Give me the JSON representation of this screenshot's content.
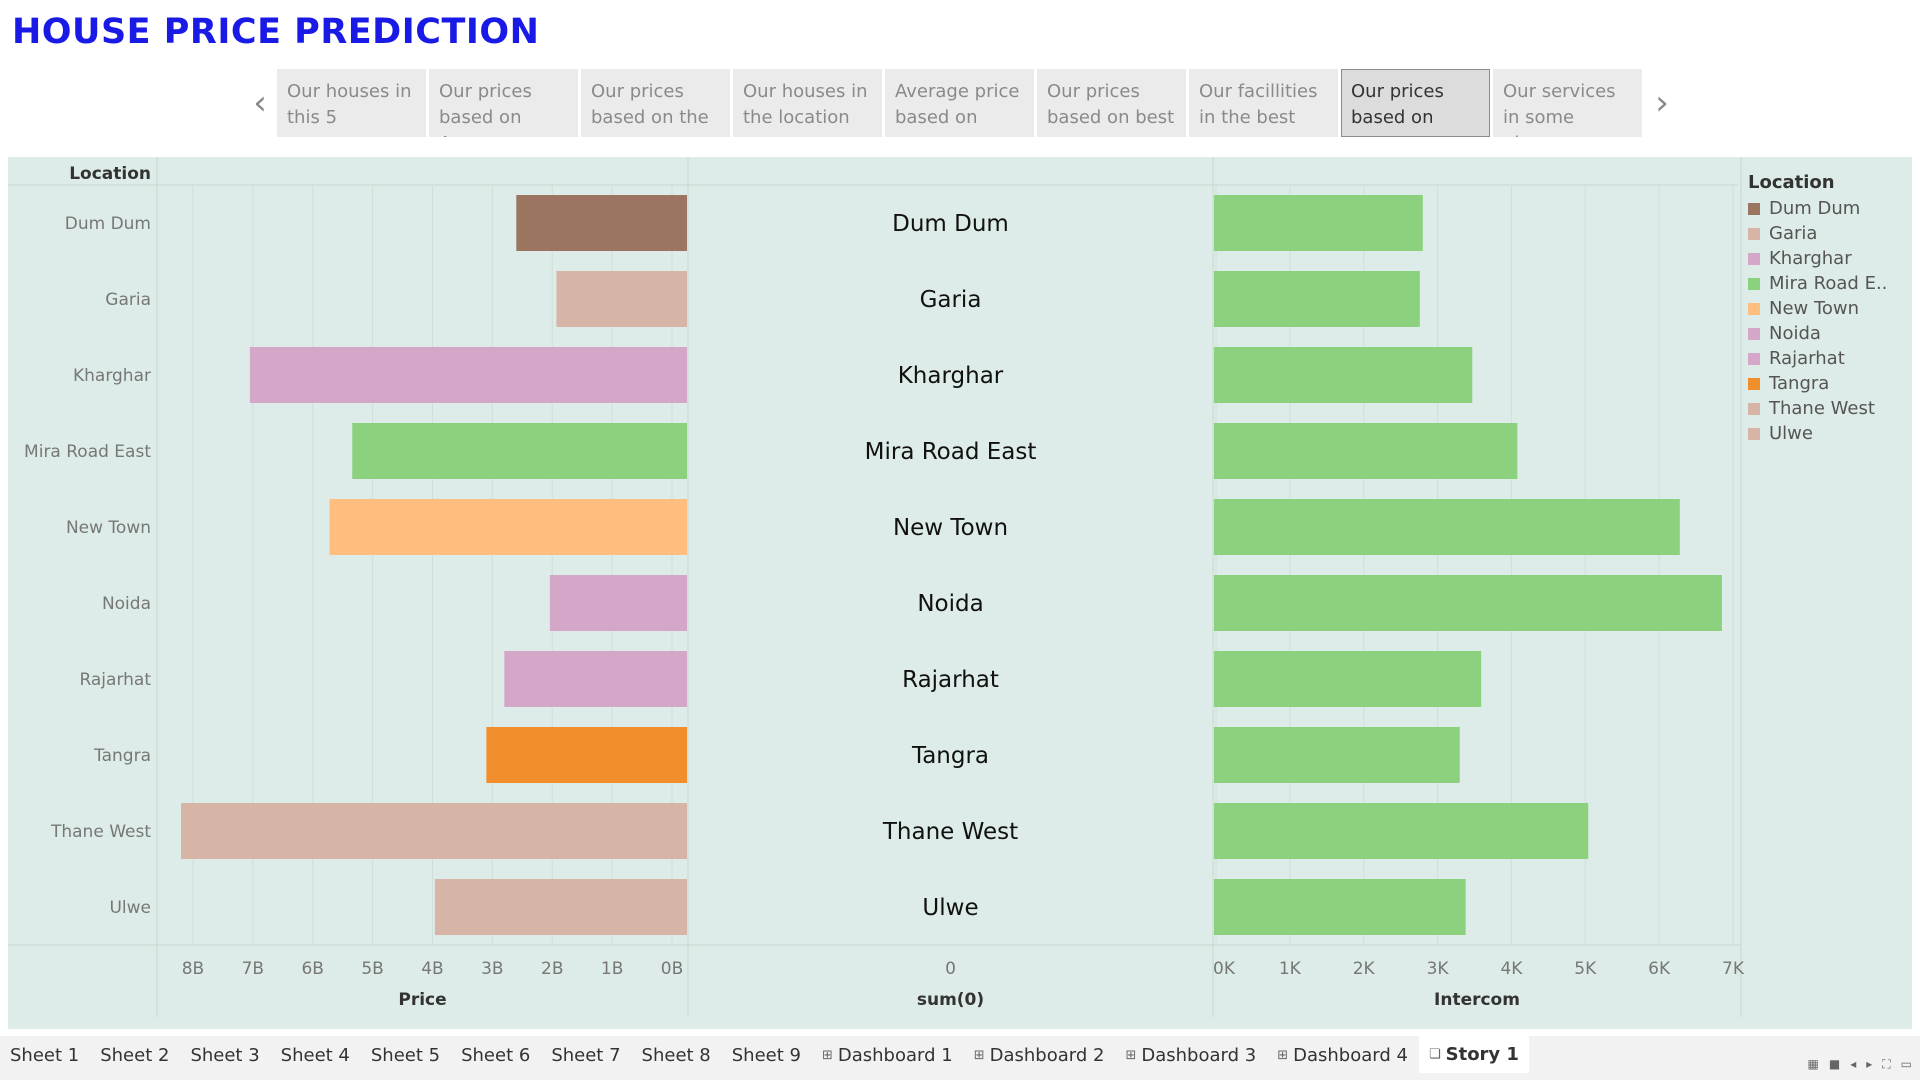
{
  "title": "HOUSE PRICE PREDICTION",
  "story_points": [
    {
      "label": "Our houses in this 5",
      "active": false
    },
    {
      "label": "Our prices based on Area",
      "active": false
    },
    {
      "label": "Our prices based on the",
      "active": false
    },
    {
      "label": "Our houses in the location",
      "active": false
    },
    {
      "label": "Average price based on",
      "active": false
    },
    {
      "label": "Our prices based on best",
      "active": false
    },
    {
      "label": "Our facillities in the best",
      "active": false
    },
    {
      "label": "Our prices based on",
      "active": true
    },
    {
      "label": "Our services in some places",
      "active": false
    }
  ],
  "nav": {
    "prev_icon": "chevron-left-icon",
    "next_icon": "chevron-right-icon"
  },
  "chart_data": {
    "type": "bar",
    "row_header": "Location",
    "categories": [
      "Dum Dum",
      "Garia",
      "Kharghar",
      "Mira Road East",
      "New Town",
      "Noida",
      "Rajarhat",
      "Tangra",
      "Thane West",
      "Ulwe"
    ],
    "colors": [
      "#9c7560",
      "#d7b5a6",
      "#d4a6c8",
      "#8cd17d",
      "#ffbe7d",
      "#d4a6c8",
      "#d4a6c8",
      "#f28e2b",
      "#d7b5a6",
      "#d7b5a6"
    ],
    "panels": [
      {
        "axis_label": "Price",
        "reversed": true,
        "range": [
          0,
          8200000000
        ],
        "ticks": [
          0,
          1000000000,
          2000000000,
          3000000000,
          4000000000,
          5000000000,
          6000000000,
          7000000000,
          8000000000
        ],
        "tick_labels": [
          "0B",
          "1B",
          "2B",
          "3B",
          "4B",
          "5B",
          "6B",
          "7B",
          "8B"
        ],
        "values": [
          2600000000,
          1930000000,
          7050000000,
          5340000000,
          5720000000,
          2040000000,
          2800000000,
          3100000000,
          8200000000,
          3960000000
        ]
      },
      {
        "axis_label": "sum(0)",
        "tick_labels": [
          "0"
        ]
      },
      {
        "axis_label": "Intercom",
        "reversed": false,
        "range": [
          0,
          7000
        ],
        "ticks": [
          0,
          1000,
          2000,
          3000,
          4000,
          5000,
          6000,
          7000
        ],
        "tick_labels": [
          "0K",
          "1K",
          "2K",
          "3K",
          "4K",
          "5K",
          "6K",
          "7K"
        ],
        "bar_color": "#8cd17d",
        "values": [
          2800,
          2760,
          3470,
          4080,
          6280,
          6850,
          3590,
          3300,
          5040,
          3380
        ]
      }
    ]
  },
  "legend": {
    "title": "Location",
    "items": [
      {
        "label": "Dum Dum",
        "color": "#9c7560"
      },
      {
        "label": "Garia",
        "color": "#d7b5a6"
      },
      {
        "label": "Kharghar",
        "color": "#d4a6c8"
      },
      {
        "label": "Mira Road E..",
        "color": "#8cd17d"
      },
      {
        "label": "New Town",
        "color": "#ffbe7d"
      },
      {
        "label": "Noida",
        "color": "#d4a6c8"
      },
      {
        "label": "Rajarhat",
        "color": "#d4a6c8"
      },
      {
        "label": "Tangra",
        "color": "#f28e2b"
      },
      {
        "label": "Thane West",
        "color": "#d7b5a6"
      },
      {
        "label": "Ulwe",
        "color": "#d7b5a6"
      }
    ]
  },
  "tabs": [
    {
      "label": "Sheet 1",
      "kind": "sheet"
    },
    {
      "label": "Sheet 2",
      "kind": "sheet"
    },
    {
      "label": "Sheet 3",
      "kind": "sheet"
    },
    {
      "label": "Sheet 4",
      "kind": "sheet"
    },
    {
      "label": "Sheet 5",
      "kind": "sheet"
    },
    {
      "label": "Sheet 6",
      "kind": "sheet"
    },
    {
      "label": "Sheet 7",
      "kind": "sheet"
    },
    {
      "label": "Sheet 8",
      "kind": "sheet"
    },
    {
      "label": "Sheet 9",
      "kind": "sheet"
    },
    {
      "label": "Dashboard 1",
      "kind": "dashboard"
    },
    {
      "label": "Dashboard 2",
      "kind": "dashboard"
    },
    {
      "label": "Dashboard 3",
      "kind": "dashboard"
    },
    {
      "label": "Dashboard 4",
      "kind": "dashboard"
    },
    {
      "label": "Story 1",
      "kind": "story",
      "active": true
    }
  ]
}
